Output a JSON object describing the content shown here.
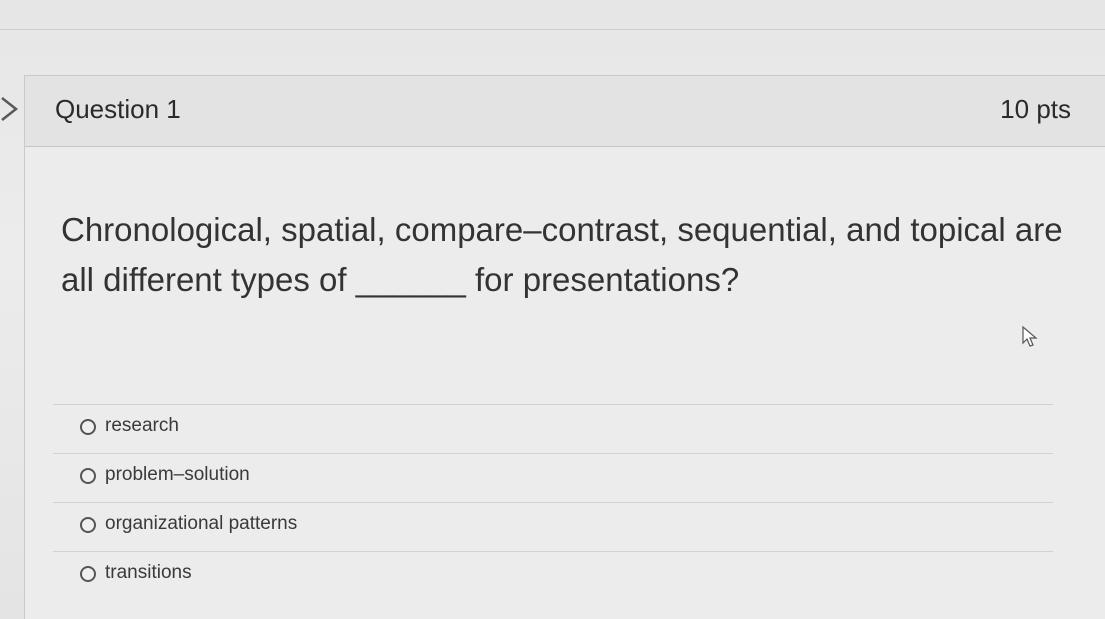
{
  "question": {
    "title": "Question 1",
    "points": "10 pts",
    "text": "Chronological, spatial, compare–contrast, sequential, and topical are all different types of ______ for presentations?"
  },
  "answers": [
    {
      "label": "research"
    },
    {
      "label": "problem–solution"
    },
    {
      "label": "organizational patterns"
    },
    {
      "label": "transitions"
    }
  ],
  "icons": {
    "expand": "chevron-right-icon",
    "radio": "radio-unselected-icon",
    "cursor": "mouse-pointer-icon"
  }
}
